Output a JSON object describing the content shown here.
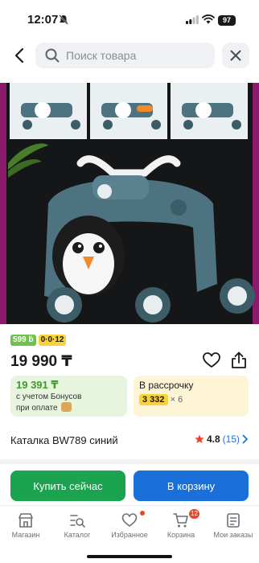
{
  "status_bar": {
    "time": "12:07",
    "battery": "97",
    "icons": [
      "bell-off-icon",
      "signal-icon",
      "wifi-icon",
      "battery-icon"
    ]
  },
  "search": {
    "placeholder": "Поиск товара",
    "icons": [
      "back-arrow-icon",
      "search-icon",
      "close-icon"
    ]
  },
  "product": {
    "bonus_badge": "599 ḃ",
    "installment_badge": "0·0·12",
    "price": "19 990 ₸",
    "icons": [
      "heart-icon",
      "share-icon"
    ],
    "bonus_card": {
      "price": "19 391 ₸",
      "note_line1": "с учетом Бонусов",
      "note_line2": "при оплате"
    },
    "installment_card": {
      "title": "В рассрочку",
      "amount": "3 332",
      "multiplier": "× 6"
    },
    "title": "Каталка BW789 синий",
    "rating": "4.8",
    "reviews": "(15)"
  },
  "actions": {
    "buy_now": "Купить сейчас",
    "to_cart": "В корзину"
  },
  "bottom_nav": {
    "items": [
      {
        "label": "Магазин",
        "icon": "shop-icon"
      },
      {
        "label": "Каталог",
        "icon": "catalog-icon"
      },
      {
        "label": "Избранное",
        "icon": "heart-icon"
      },
      {
        "label": "Корзина",
        "icon": "cart-icon"
      },
      {
        "label": "Мои заказы",
        "icon": "orders-icon"
      }
    ],
    "cart_count": "12"
  },
  "colors": {
    "accent_green": "#1ba34f",
    "accent_blue": "#1a6fd8",
    "badge_green": "#6cc24a",
    "badge_yellow": "#f7d23a",
    "alert_red": "#e8462b"
  }
}
